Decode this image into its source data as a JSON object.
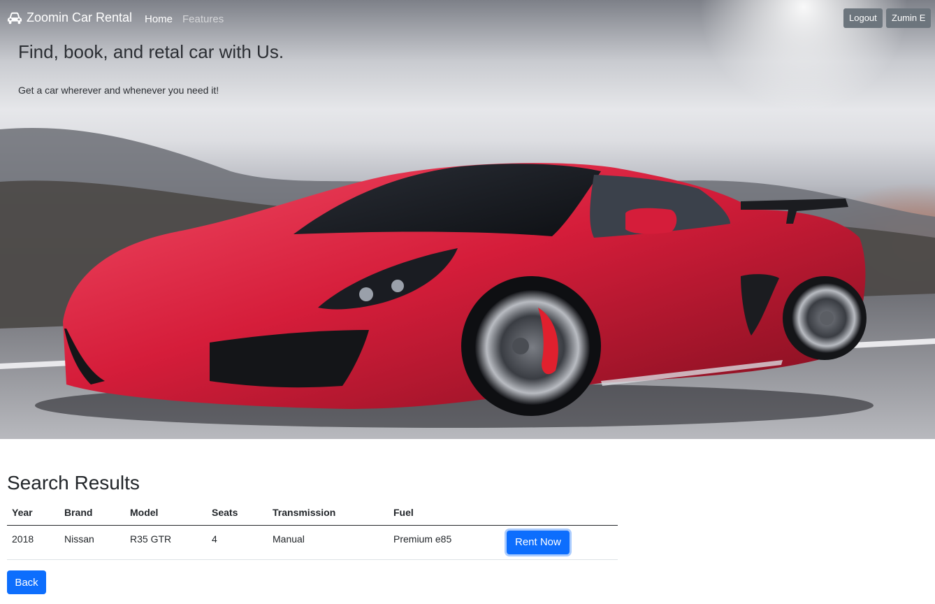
{
  "navbar": {
    "brand": "Zoomin Car Rental",
    "brand_icon": "car-icon",
    "links": [
      {
        "label": "Home",
        "active": true
      },
      {
        "label": "Features",
        "active": false
      }
    ],
    "logout_label": "Logout",
    "user_label": "Zumin E"
  },
  "hero": {
    "title": "Find, book, and retal car with Us.",
    "subtitle": "Get a car wherever and whenever you need it!",
    "image": "red-sports-car-photo"
  },
  "results": {
    "title": "Search Results",
    "columns": [
      "Year",
      "Brand",
      "Model",
      "Seats",
      "Transmission",
      "Fuel"
    ],
    "rows": [
      {
        "year": "2018",
        "brand": "Nissan",
        "model": "R35 GTR",
        "seats": "4",
        "transmission": "Manual",
        "fuel": "Premium e85",
        "action": "Rent Now"
      }
    ]
  },
  "back_label": "Back",
  "colors": {
    "primary": "#0d6efd",
    "secondary": "#6c757d",
    "car": "#d3203b"
  }
}
